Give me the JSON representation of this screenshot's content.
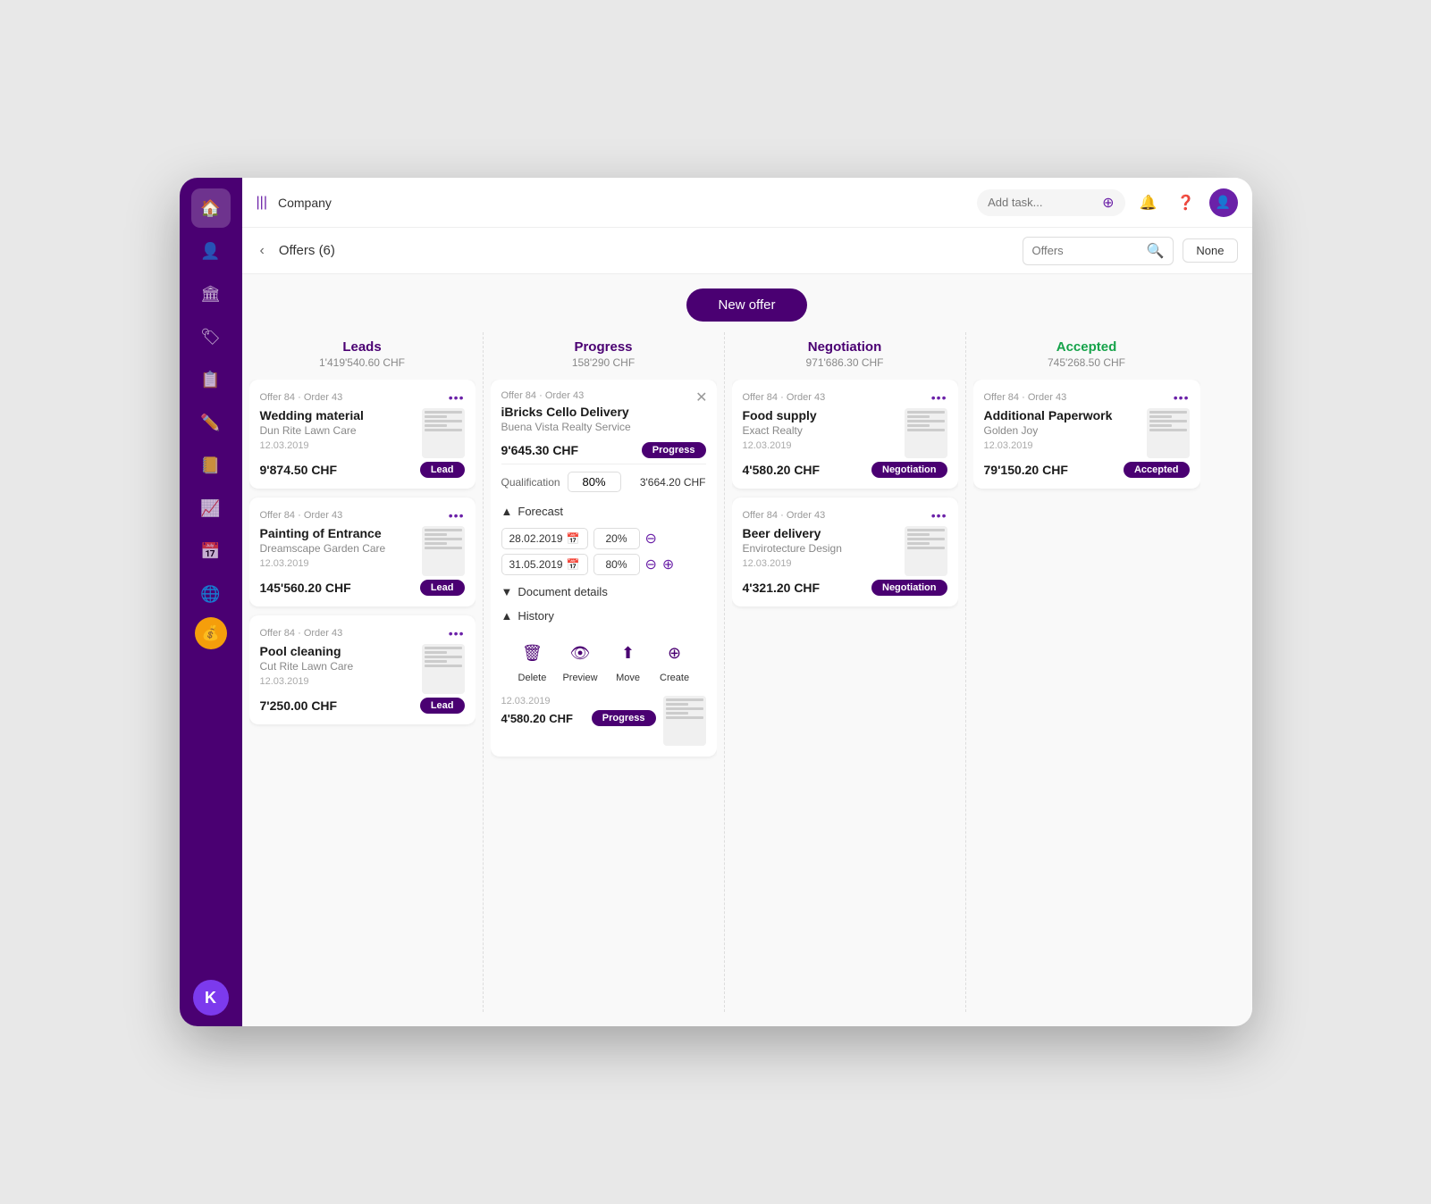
{
  "app": {
    "title": "Company"
  },
  "topbar": {
    "menu_icon": "|||",
    "add_task_placeholder": "Add task...",
    "bell_icon": "🔔",
    "help_icon": "?",
    "avatar_icon": "👤"
  },
  "subheader": {
    "back_label": "‹",
    "title": "Offers (6)",
    "search_placeholder": "Offers",
    "filter_label": "None"
  },
  "new_offer": {
    "label": "New offer"
  },
  "columns": [
    {
      "id": "leads",
      "title": "Leads",
      "amount": "1'419'540.60 CHF",
      "title_color": "purple"
    },
    {
      "id": "progress",
      "title": "Progress",
      "amount": "158'290 CHF",
      "title_color": "purple"
    },
    {
      "id": "negotiation",
      "title": "Negotiation",
      "amount": "971'686.30 CHF",
      "title_color": "purple"
    },
    {
      "id": "accepted",
      "title": "Accepted",
      "amount": "745'268.50 CHF",
      "title_color": "green"
    }
  ],
  "cards": {
    "leads": [
      {
        "meta": "Offer 84 · Order 43",
        "title": "Wedding material",
        "subtitle": "Dun Rite Lawn Care",
        "date": "12.03.2019",
        "amount": "9'874.50 CHF",
        "badge": "Lead",
        "badge_type": "lead"
      },
      {
        "meta": "Offer 84 · Order 43",
        "title": "Painting of Entrance",
        "subtitle": "Dreamscape Garden Care",
        "date": "12.03.2019",
        "amount": "145'560.20 CHF",
        "badge": "Lead",
        "badge_type": "lead"
      },
      {
        "meta": "Offer 84 · Order 43",
        "title": "Pool cleaning",
        "subtitle": "Cut Rite Lawn Care",
        "date": "12.03.2019",
        "amount": "7'250.00 CHF",
        "badge": "Lead",
        "badge_type": "lead"
      }
    ],
    "progress": [
      {
        "meta": "Offer 84 · Order 43",
        "title": "iBricks Cello Delivery",
        "subtitle": "Buena Vista Realty Service",
        "date": "",
        "amount": "9'645.30 CHF",
        "badge": "Progress",
        "badge_type": "progress",
        "expanded": true,
        "qualification": {
          "label": "Qualification",
          "value": "80%",
          "amount": "3'664.20 CHF"
        },
        "forecast": {
          "label": "Forecast",
          "rows": [
            {
              "date": "28.02.2019",
              "pct": "20%"
            },
            {
              "date": "31.05.2019",
              "pct": "80%"
            }
          ]
        },
        "document_details": "Document details",
        "history": {
          "label": "History",
          "actions": [
            "Delete",
            "Preview",
            "Move",
            "Create"
          ],
          "entry_date": "12.03.2019",
          "entry_amount": "4'580.20 CHF",
          "entry_badge": "Progress",
          "entry_badge_type": "progress"
        }
      }
    ],
    "negotiation": [
      {
        "meta": "Offer 84 · Order 43",
        "title": "Food supply",
        "subtitle": "Exact Realty",
        "date": "12.03.2019",
        "amount": "4'580.20 CHF",
        "badge": "Negotiation",
        "badge_type": "negotiation"
      },
      {
        "meta": "Offer 84 · Order 43",
        "title": "Beer delivery",
        "subtitle": "Envirotecture Design",
        "date": "12.03.2019",
        "amount": "4'321.20 CHF",
        "badge": "Negotiation",
        "badge_type": "negotiation"
      }
    ],
    "accepted": [
      {
        "meta": "Offer 84 · Order 43",
        "title": "Additional Paperwork",
        "subtitle": "Golden Joy",
        "date": "12.03.2019",
        "amount": "79'150.20 CHF",
        "badge": "Accepted",
        "badge_type": "accepted"
      }
    ]
  },
  "sidebar": {
    "icons": [
      "🏠",
      "👤",
      "🏛",
      "🏷",
      "📋",
      "✏️",
      "📒",
      "📈",
      "📅",
      "🌐",
      "💰",
      "👤"
    ],
    "bottom_icon": "K"
  }
}
